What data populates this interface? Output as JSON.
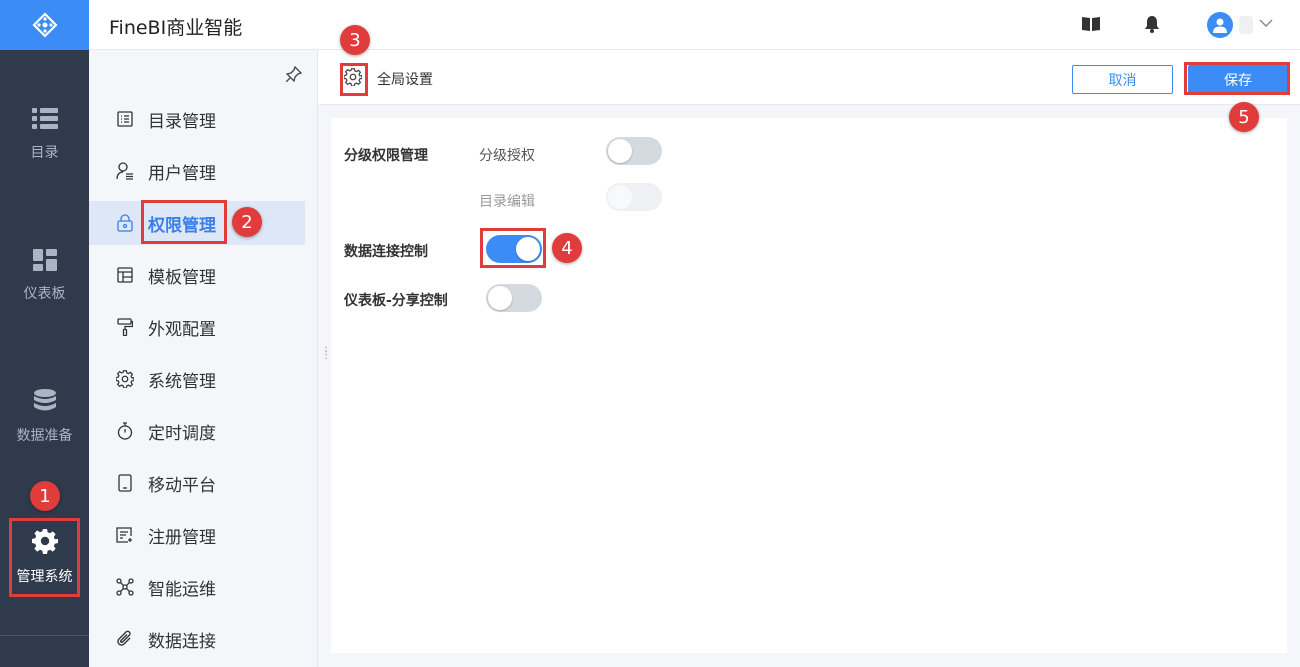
{
  "app": {
    "title": "FineBI商业智能"
  },
  "rail": {
    "items": [
      {
        "label": "目录",
        "icon": "list-icon"
      },
      {
        "label": "仪表板",
        "icon": "dashboard-icon"
      },
      {
        "label": "数据准备",
        "icon": "database-icon"
      },
      {
        "label": "管理系统",
        "icon": "gear-icon",
        "active": true
      }
    ]
  },
  "sidebar": {
    "items": [
      {
        "label": "目录管理",
        "icon": "catalog-icon"
      },
      {
        "label": "用户管理",
        "icon": "user-icon"
      },
      {
        "label": "权限管理",
        "icon": "lock-icon",
        "active": true
      },
      {
        "label": "模板管理",
        "icon": "template-icon"
      },
      {
        "label": "外观配置",
        "icon": "paint-roller-icon"
      },
      {
        "label": "系统管理",
        "icon": "settings-icon"
      },
      {
        "label": "定时调度",
        "icon": "stopwatch-icon"
      },
      {
        "label": "移动平台",
        "icon": "tablet-icon"
      },
      {
        "label": "注册管理",
        "icon": "register-icon"
      },
      {
        "label": "智能运维",
        "icon": "network-icon"
      },
      {
        "label": "数据连接",
        "icon": "paperclip-icon"
      }
    ]
  },
  "header": {
    "title": "全局设置",
    "cancel_label": "取消",
    "save_label": "保存"
  },
  "settings": {
    "hierarchy_label": "分级权限管理",
    "hierarchy_auth_label": "分级授权",
    "hierarchy_auth_on": false,
    "catalog_edit_label": "目录编辑",
    "catalog_edit_on": false,
    "catalog_edit_disabled": true,
    "data_conn_label": "数据连接控制",
    "data_conn_on": true,
    "dashboard_share_label": "仪表板-分享控制",
    "dashboard_share_on": false
  },
  "annotations": [
    "1",
    "2",
    "3",
    "4",
    "5"
  ],
  "colors": {
    "accent": "#3b8cf5",
    "rail_bg": "#2f3a4c",
    "annotation": "#e03c3c"
  }
}
